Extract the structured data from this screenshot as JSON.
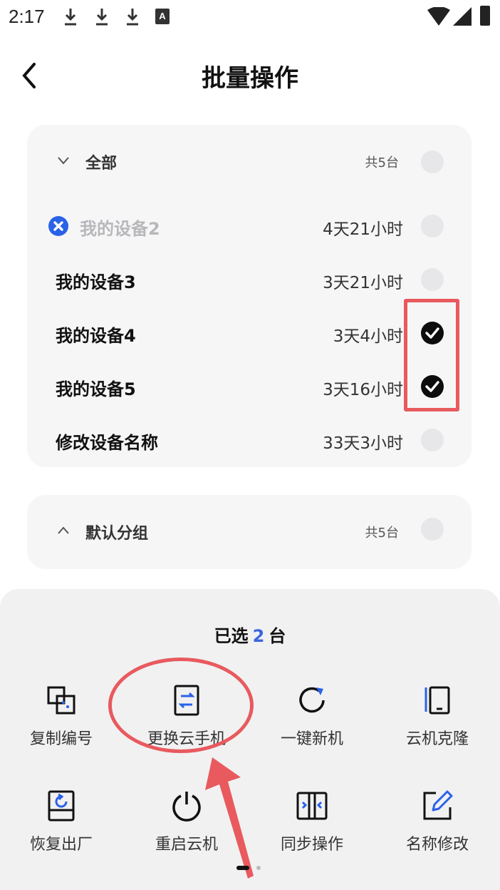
{
  "status": {
    "time": "2:17",
    "a_badge": "A"
  },
  "header": {
    "title": "批量操作"
  },
  "groups": [
    {
      "label": "全部",
      "count": "共5台",
      "expanded": true
    },
    {
      "label": "默认分组",
      "count": "共5台",
      "expanded": false
    }
  ],
  "devices": [
    {
      "name": "我的设备2",
      "time": "4天21小时",
      "checked": false,
      "disabled": true
    },
    {
      "name": "我的设备3",
      "time": "3天21小时",
      "checked": false,
      "disabled": false
    },
    {
      "name": "我的设备4",
      "time": "3天4小时",
      "checked": true,
      "disabled": false
    },
    {
      "name": "我的设备5",
      "time": "3天16小时",
      "checked": true,
      "disabled": false
    },
    {
      "name": "修改设备名称",
      "time": "33天3小时",
      "checked": false,
      "disabled": false
    }
  ],
  "sheet": {
    "selected_prefix": "已选",
    "selected_count": "2",
    "selected_suffix": "台",
    "actions": [
      {
        "label": "复制编号",
        "icon": "copy-id-icon"
      },
      {
        "label": "更换云手机",
        "icon": "swap-phone-icon"
      },
      {
        "label": "一键新机",
        "icon": "refresh-icon"
      },
      {
        "label": "云机克隆",
        "icon": "clone-icon"
      },
      {
        "label": "恢复出厂",
        "icon": "factory-reset-icon"
      },
      {
        "label": "重启云机",
        "icon": "power-icon"
      },
      {
        "label": "同步操作",
        "icon": "sync-icon"
      },
      {
        "label": "名称修改",
        "icon": "edit-icon"
      }
    ]
  },
  "colors": {
    "accent": "#3a64e0",
    "annotation": "#e85a5e",
    "card_bg": "#f6f6f7"
  }
}
